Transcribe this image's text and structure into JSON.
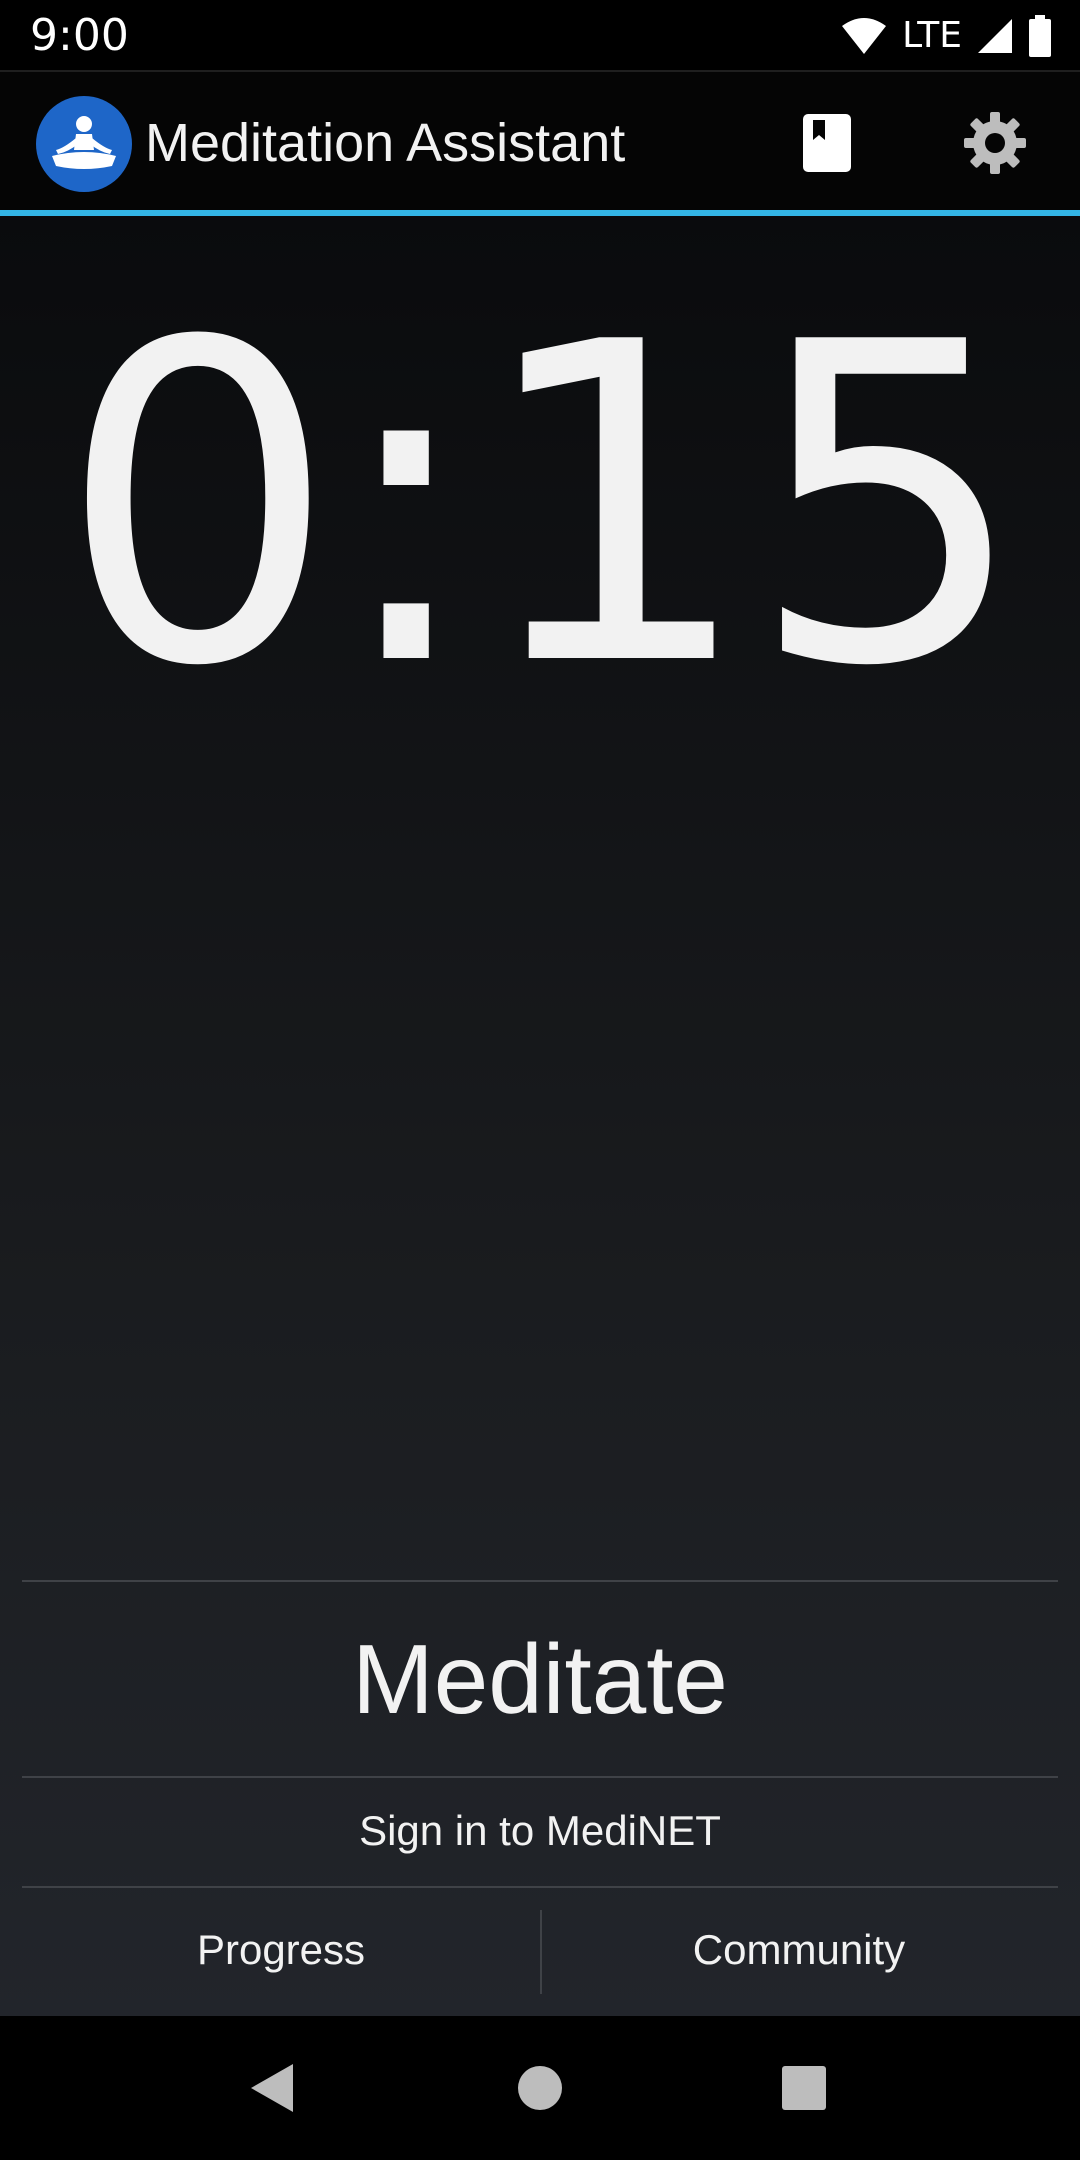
{
  "status_bar": {
    "time": "9:00",
    "network": "LTE",
    "icons": [
      "wifi-icon",
      "signal-icon",
      "battery-icon"
    ]
  },
  "app_bar": {
    "title": "Meditation Assistant",
    "logo": "meditation-logo-icon",
    "actions": [
      "bookmark-icon",
      "settings-gear-icon"
    ]
  },
  "timer": {
    "display": "0:15"
  },
  "actions": {
    "meditate_label": "Meditate",
    "signin_label": "Sign in to MediNET",
    "progress_label": "Progress",
    "community_label": "Community"
  },
  "nav_bar": {
    "buttons": [
      "back-icon",
      "home-icon",
      "recents-icon"
    ]
  },
  "colors": {
    "accent": "#33b5e5",
    "logo_blue": "#1e66c8",
    "text": "#f2f2f2"
  }
}
